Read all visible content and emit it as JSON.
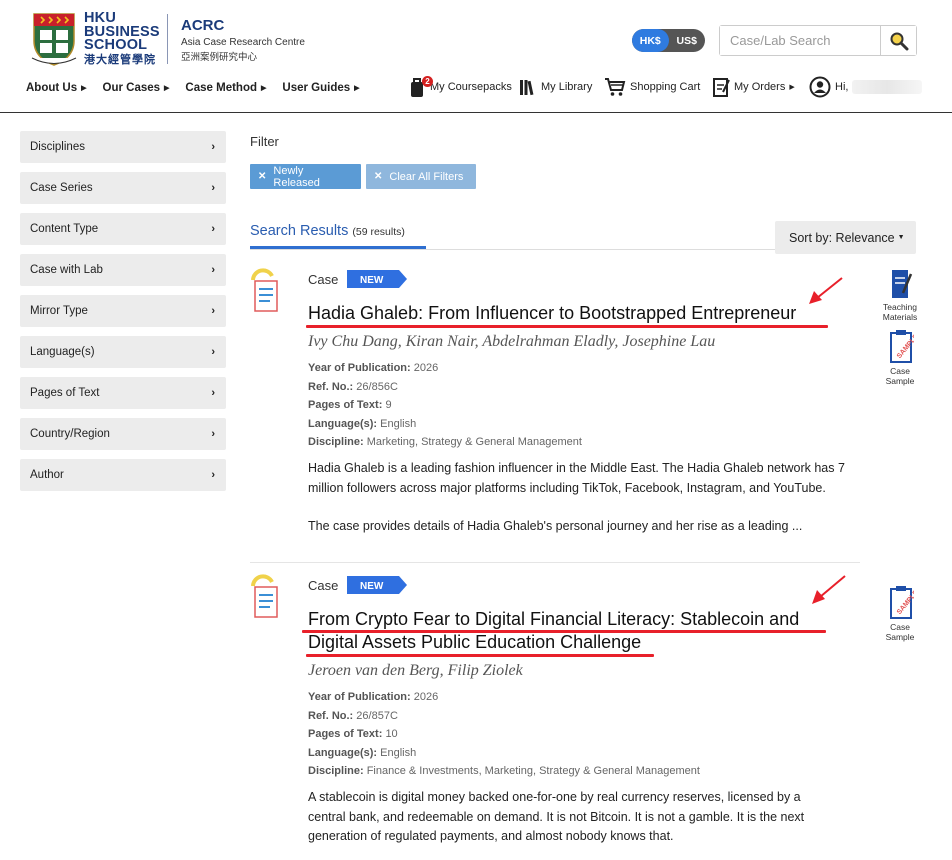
{
  "brand": {
    "school_line1": "HKU",
    "school_line2": "BUSINESS",
    "school_line3": "SCHOOL",
    "school_cn": "港大經管學院",
    "centre_abbr": "ACRC",
    "centre_en": "Asia Case Research Centre",
    "centre_cn": "亞洲案例研究中心"
  },
  "currency": {
    "options": [
      "HK$",
      "US$"
    ],
    "selected": "HK$"
  },
  "search": {
    "placeholder": "Case/Lab Search"
  },
  "nav": [
    "About Us",
    "Our Cases",
    "Case Method",
    "User Guides"
  ],
  "account": {
    "coursepacks": "My Coursepacks",
    "coursepacks_badge": "2",
    "library": "My Library",
    "cart": "Shopping Cart",
    "orders": "My Orders",
    "greeting": "Hi,"
  },
  "sidebar": [
    "Disciplines",
    "Case Series",
    "Content Type",
    "Case with Lab",
    "Mirror Type",
    "Language(s)",
    "Pages of Text",
    "Country/Region",
    "Author"
  ],
  "filter": {
    "label": "Filter",
    "chips": [
      "Newly Released",
      "Clear All Filters"
    ]
  },
  "results": {
    "title": "Search Results",
    "count": "(59 results)",
    "sort": "Sort by: Relevance"
  },
  "meta_labels": {
    "year": "Year of Publication:",
    "ref": "Ref. No.:",
    "pages": "Pages of Text:",
    "lang": "Language(s):",
    "disc": "Discipline:"
  },
  "cases": [
    {
      "type": "Case",
      "tag": "NEW",
      "title": "Hadia Ghaleb: From Influencer to Bootstrapped Entrepreneur",
      "authors": "Ivy Chu Dang, Kiran Nair, Abdelrahman Eladly, Josephine Lau",
      "year": "2026",
      "ref": "26/856C",
      "pages": "9",
      "language": "English",
      "discipline": "Marketing, Strategy & General Management",
      "abstract_p1": "Hadia Ghaleb is a leading fashion influencer in the Middle East. The Hadia Ghaleb network has 7 million followers across major platforms including TikTok, Facebook, Instagram, and YouTube.",
      "abstract_p2": "The case provides details of Hadia Ghaleb's personal journey and her rise as a leading ...",
      "resources": [
        "Teaching Materials",
        "Case Sample"
      ]
    },
    {
      "type": "Case",
      "tag": "NEW",
      "title": "From Crypto Fear to Digital Financial Literacy: Stablecoin and Digital Assets Public Education Challenge",
      "authors": "Jeroen van den Berg, Filip Ziolek",
      "year": "2026",
      "ref": "26/857C",
      "pages": "10",
      "language": "English",
      "discipline": "Finance & Investments, Marketing, Strategy & General Management",
      "abstract_p1": "A stablecoin is digital money backed one-for-one by real currency reserves, licensed by a central bank, and redeemable on demand. It is not Bitcoin. It is not a gamble. It is the next generation of regulated payments, and almost nobody knows that.",
      "resources": [
        "Case Sample"
      ]
    }
  ],
  "colors": {
    "brand_blue": "#1b3b7a",
    "accent_blue": "#2f7be0",
    "annotation_red": "#e8202a"
  }
}
